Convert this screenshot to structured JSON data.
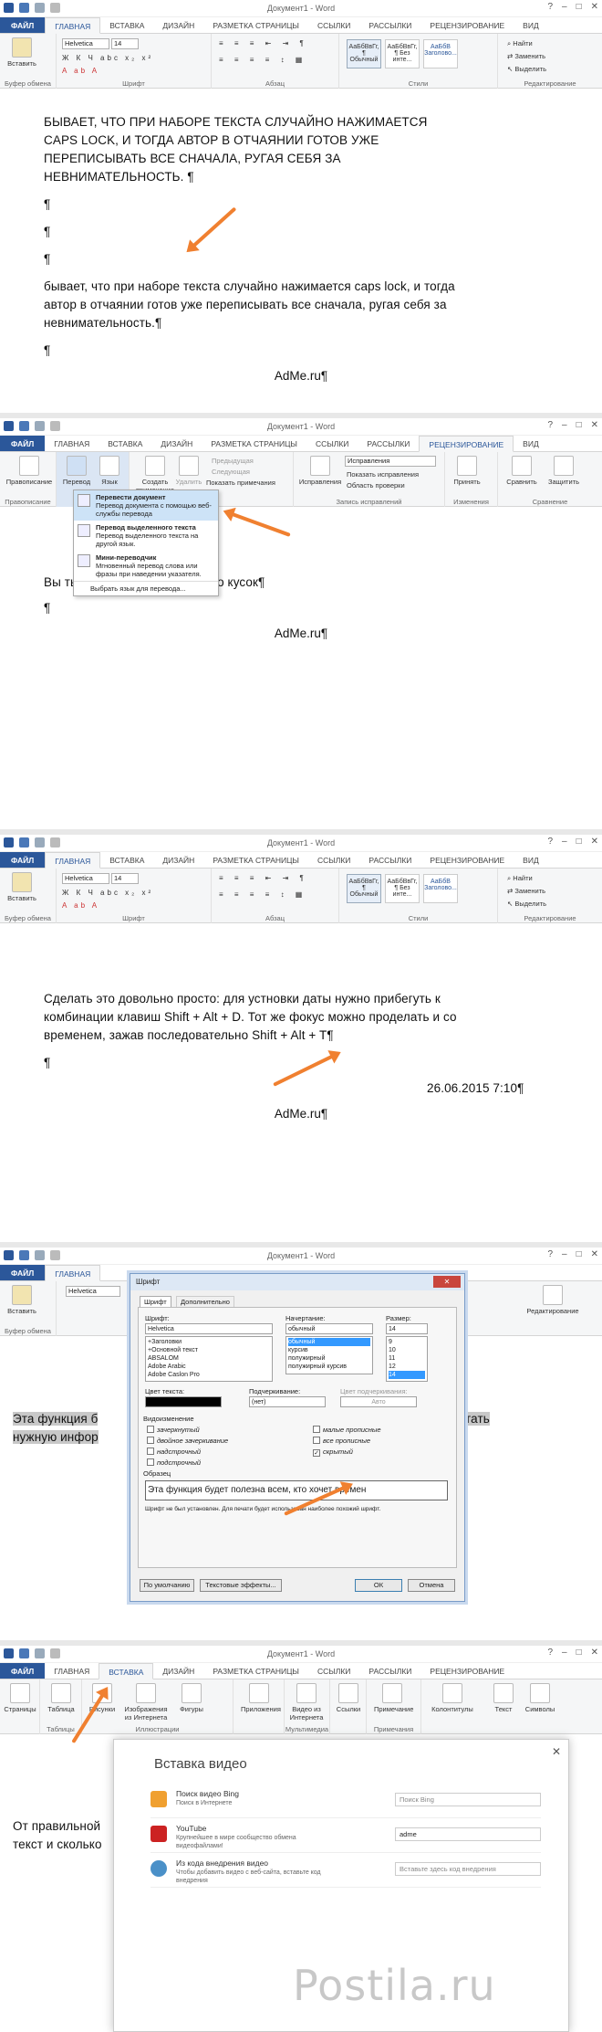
{
  "window_title": "Документ1 - Word",
  "tabs_home": [
    "ФАЙЛ",
    "ГЛАВНАЯ",
    "ВСТАВКА",
    "ДИЗАЙН",
    "РАЗМЕТКА СТРАНИЦЫ",
    "ССЫЛКИ",
    "РАССЫЛКИ",
    "РЕЦЕНЗИРОВАНИЕ",
    "ВИД"
  ],
  "home_ribbon": {
    "paste": "Вставить",
    "clipboard": "Буфер обмена",
    "font_name": "Helvetica",
    "font_size": "14",
    "font_group": "Шрифт",
    "paragraph_group": "Абзац",
    "styles": [
      "АаБбВвГг,",
      "АаБбВвГг,",
      "АаБбВ"
    ],
    "style_names": [
      "¶ Обычный",
      "¶ Без инте...",
      "Заголово..."
    ],
    "styles_group": "Стили",
    "find": "Найти",
    "replace": "Заменить",
    "select": "Выделить",
    "editing_group": "Редактирование"
  },
  "panel1": {
    "lines": [
      "БЫВАЕТ, ЧТО ПРИ НАБОРЕ ТЕКСТА СЛУЧАЙНО НАЖИМАЕТСЯ",
      "CAPS LOCK, И ТОГДА АВТОР В ОТЧАЯНИИ ГОТОВ УЖЕ",
      "ПЕРЕПИСЫВАТЬ ВСЕ СНАЧАЛА, РУГАЯ СЕБЯ ЗА",
      "НЕВНИМАТЕЛЬНОСТЬ. ¶"
    ],
    "pilcrows": [
      "¶",
      "¶",
      "¶"
    ],
    "lower_lines": [
      "бывает, что при наборе текста случайно нажимается caps lock, и тогда",
      "автор в отчаянии готов уже переписывать все сначала, ругая себя за",
      "невнимательность.¶"
    ],
    "last_pilcrow": "¶",
    "footer": "AdMe.ru¶"
  },
  "panel2": {
    "review_tab": "РЕЦЕНЗИРОВАНИЕ",
    "ribbon_items": [
      "Правописание",
      "Перевод",
      "Язык",
      "Создать примечание",
      "Удалить",
      "Предыдущая",
      "Следующая",
      "Показать примечания",
      "Исправления",
      "Исправления",
      "Показать исправления",
      "Область проверки",
      "Принять",
      "Сравнить",
      "Защитить"
    ],
    "groups": [
      "Правописание",
      "Запись исправлений",
      "Изменения",
      "Сравнение"
    ],
    "menu": [
      {
        "title": "Перевести документ",
        "desc": "Перевод документа с помощью веб-службы перевода"
      },
      {
        "title": "Перевод выделенного текста",
        "desc": "Перевод выделенного текста на другой язык."
      },
      {
        "title": "Мини-переводчик",
        "desc": "Мгновенный перевод слова или фразы при наведении указателя."
      }
    ],
    "menu_footer": "Выбрать язык для перевода...",
    "doc_line": "Вы           ть документ, отдельный его кусок¶",
    "pilcrow": "¶",
    "footer": "AdMe.ru¶"
  },
  "panel3": {
    "lines": [
      "Сделать это довольно просто: для устновки даты нужно прибегуть к",
      "комбинации клавиш Shift + Alt + D. Тот же фокус можно проделать и со",
      "временем, зажав последовательно Shift + Alt + T¶"
    ],
    "pilcrow": "¶",
    "date": "26.06.2015 7:10¶",
    "footer": "AdMe.ru¶"
  },
  "panel4": {
    "dialog_title": "Шрифт",
    "dtabs": [
      "Шрифт",
      "Дополнительно"
    ],
    "font_label": "Шрифт:",
    "font_value": "Helvetica",
    "font_list": [
      "+Заголовки",
      "+Основной текст",
      "ABSALOM",
      "Adobe Arabic",
      "Adobe Caslon Pro"
    ],
    "style_label": "Начертание:",
    "style_value": "обычный",
    "style_list": [
      "обычный",
      "курсив",
      "полужирный",
      "полужирный курсив"
    ],
    "size_label": "Размер:",
    "size_value": "14",
    "size_list": [
      "9",
      "10",
      "11",
      "12",
      "14"
    ],
    "color_label": "Цвет текста:",
    "underline_label": "Подчеркивание:",
    "underline_value": "(нет)",
    "ucolor_label": "Цвет подчеркивания:",
    "ucolor_value": "Авто",
    "effects_label": "Видоизменение",
    "effects_left": [
      "зачеркнутый",
      "двойное зачеркивание",
      "надстрочный",
      "подстрочный"
    ],
    "effects_right": [
      "малые прописные",
      "все прописные",
      "скрытый"
    ],
    "sample_label": "Образец",
    "sample_text": "Эта функция будет полезна всем, кто хочет времен",
    "note": "Шрифт не был установлен. Для печати будет использован наиболее похожий шрифт.",
    "btn_default": "По умолчанию",
    "btn_effects": "Текстовые эффекты...",
    "btn_ok": "ОК",
    "btn_cancel": "Отмена",
    "doc_line1": "Эта функция б",
    "doc_line1_end": "тать",
    "doc_line2": "нужную инфор",
    "paste": "Вставить",
    "clipboard": "Буфер обмена",
    "editing": "Редактирование"
  },
  "panel5": {
    "insert_tab": "ВСТАВКА",
    "ribbon_items": [
      "Страницы",
      "Таблица",
      "Рисунки",
      "Изображения из Интернета",
      "Фигуры",
      "Приложения",
      "Видео из Интернета",
      "Ссылки",
      "Примечание",
      "Колонтитулы",
      "Текст",
      "Символы"
    ],
    "groups": [
      "Таблицы",
      "Иллюстрации",
      "Мультимедиа",
      "Примечания"
    ],
    "video_title": "Вставка видео",
    "rows": [
      {
        "title": "Поиск видео Bing",
        "desc": "Поиск в Интернете",
        "input": "Поиск Bing"
      },
      {
        "title": "YouTube",
        "desc": "Крупнейшее в мире сообщество обмена видеофайлами!",
        "input": "adme"
      },
      {
        "title": "Из кода внедрения видео",
        "desc": "Чтобы добавить видео с веб-сайта, вставьте код внедрения",
        "input": "Вставьте здесь код внедрения"
      }
    ],
    "doc_line1": "От правильной",
    "doc_line2": "текст и сколько"
  },
  "watermark": "Postila.ru",
  "colors": {
    "accent": "#2b579a",
    "arrow": "#f08030"
  }
}
